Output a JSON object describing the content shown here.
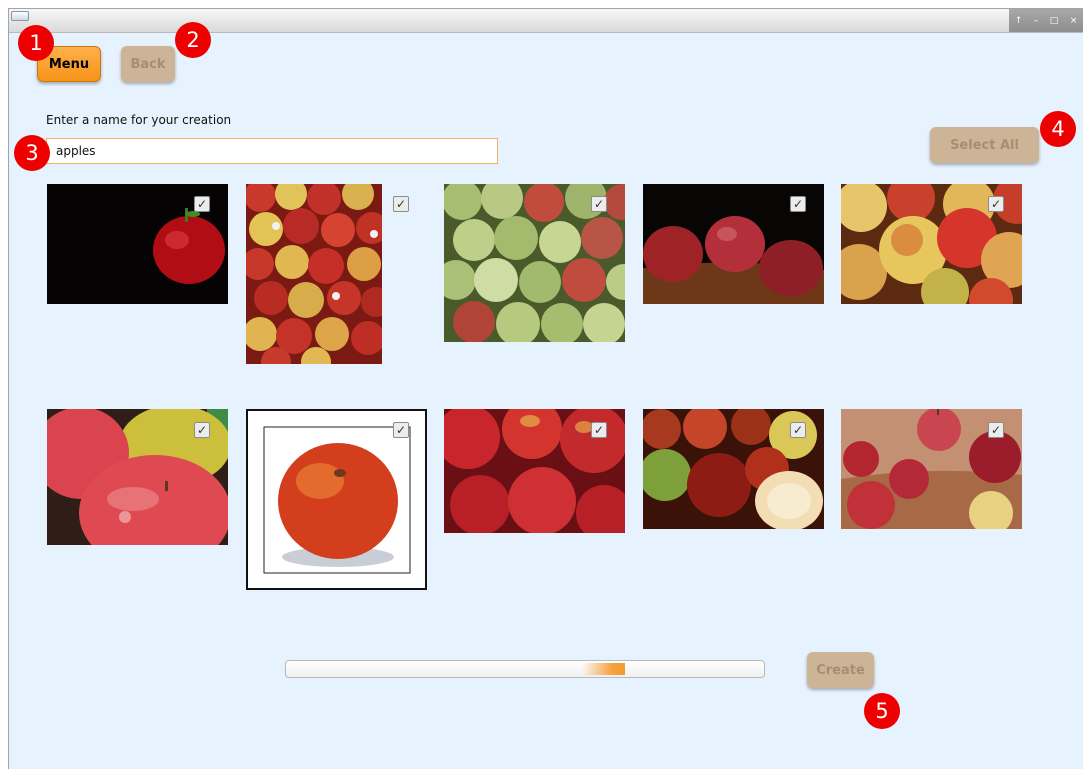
{
  "window": {
    "controls": [
      "↑",
      "–",
      "□",
      "×"
    ]
  },
  "toolbar": {
    "menu_label": "Menu",
    "back_label": "Back"
  },
  "name_field": {
    "label": "Enter a name for your creation",
    "value": "apples"
  },
  "select_all_label": "Select All",
  "create_label": "Create",
  "progress": {
    "fill_start_fraction": 0.62,
    "fill_end_fraction": 0.71
  },
  "images": [
    {
      "checked": true,
      "check_glyph": "✓"
    },
    {
      "checked": true,
      "check_glyph": "✓"
    },
    {
      "checked": true,
      "check_glyph": "✓"
    },
    {
      "checked": true,
      "check_glyph": "✓"
    },
    {
      "checked": true,
      "check_glyph": "✓"
    },
    {
      "checked": true,
      "check_glyph": "✓"
    },
    {
      "checked": true,
      "check_glyph": "✓",
      "selected": true
    },
    {
      "checked": true,
      "check_glyph": "✓"
    },
    {
      "checked": true,
      "check_glyph": "✓"
    },
    {
      "checked": true,
      "check_glyph": "✓"
    }
  ],
  "markers": [
    "1",
    "2",
    "3",
    "4",
    "5"
  ],
  "colors": {
    "accent": "#f59418",
    "disabled_button": "#cdb496",
    "background": "#e6f2fd",
    "marker": "#ee0000"
  }
}
